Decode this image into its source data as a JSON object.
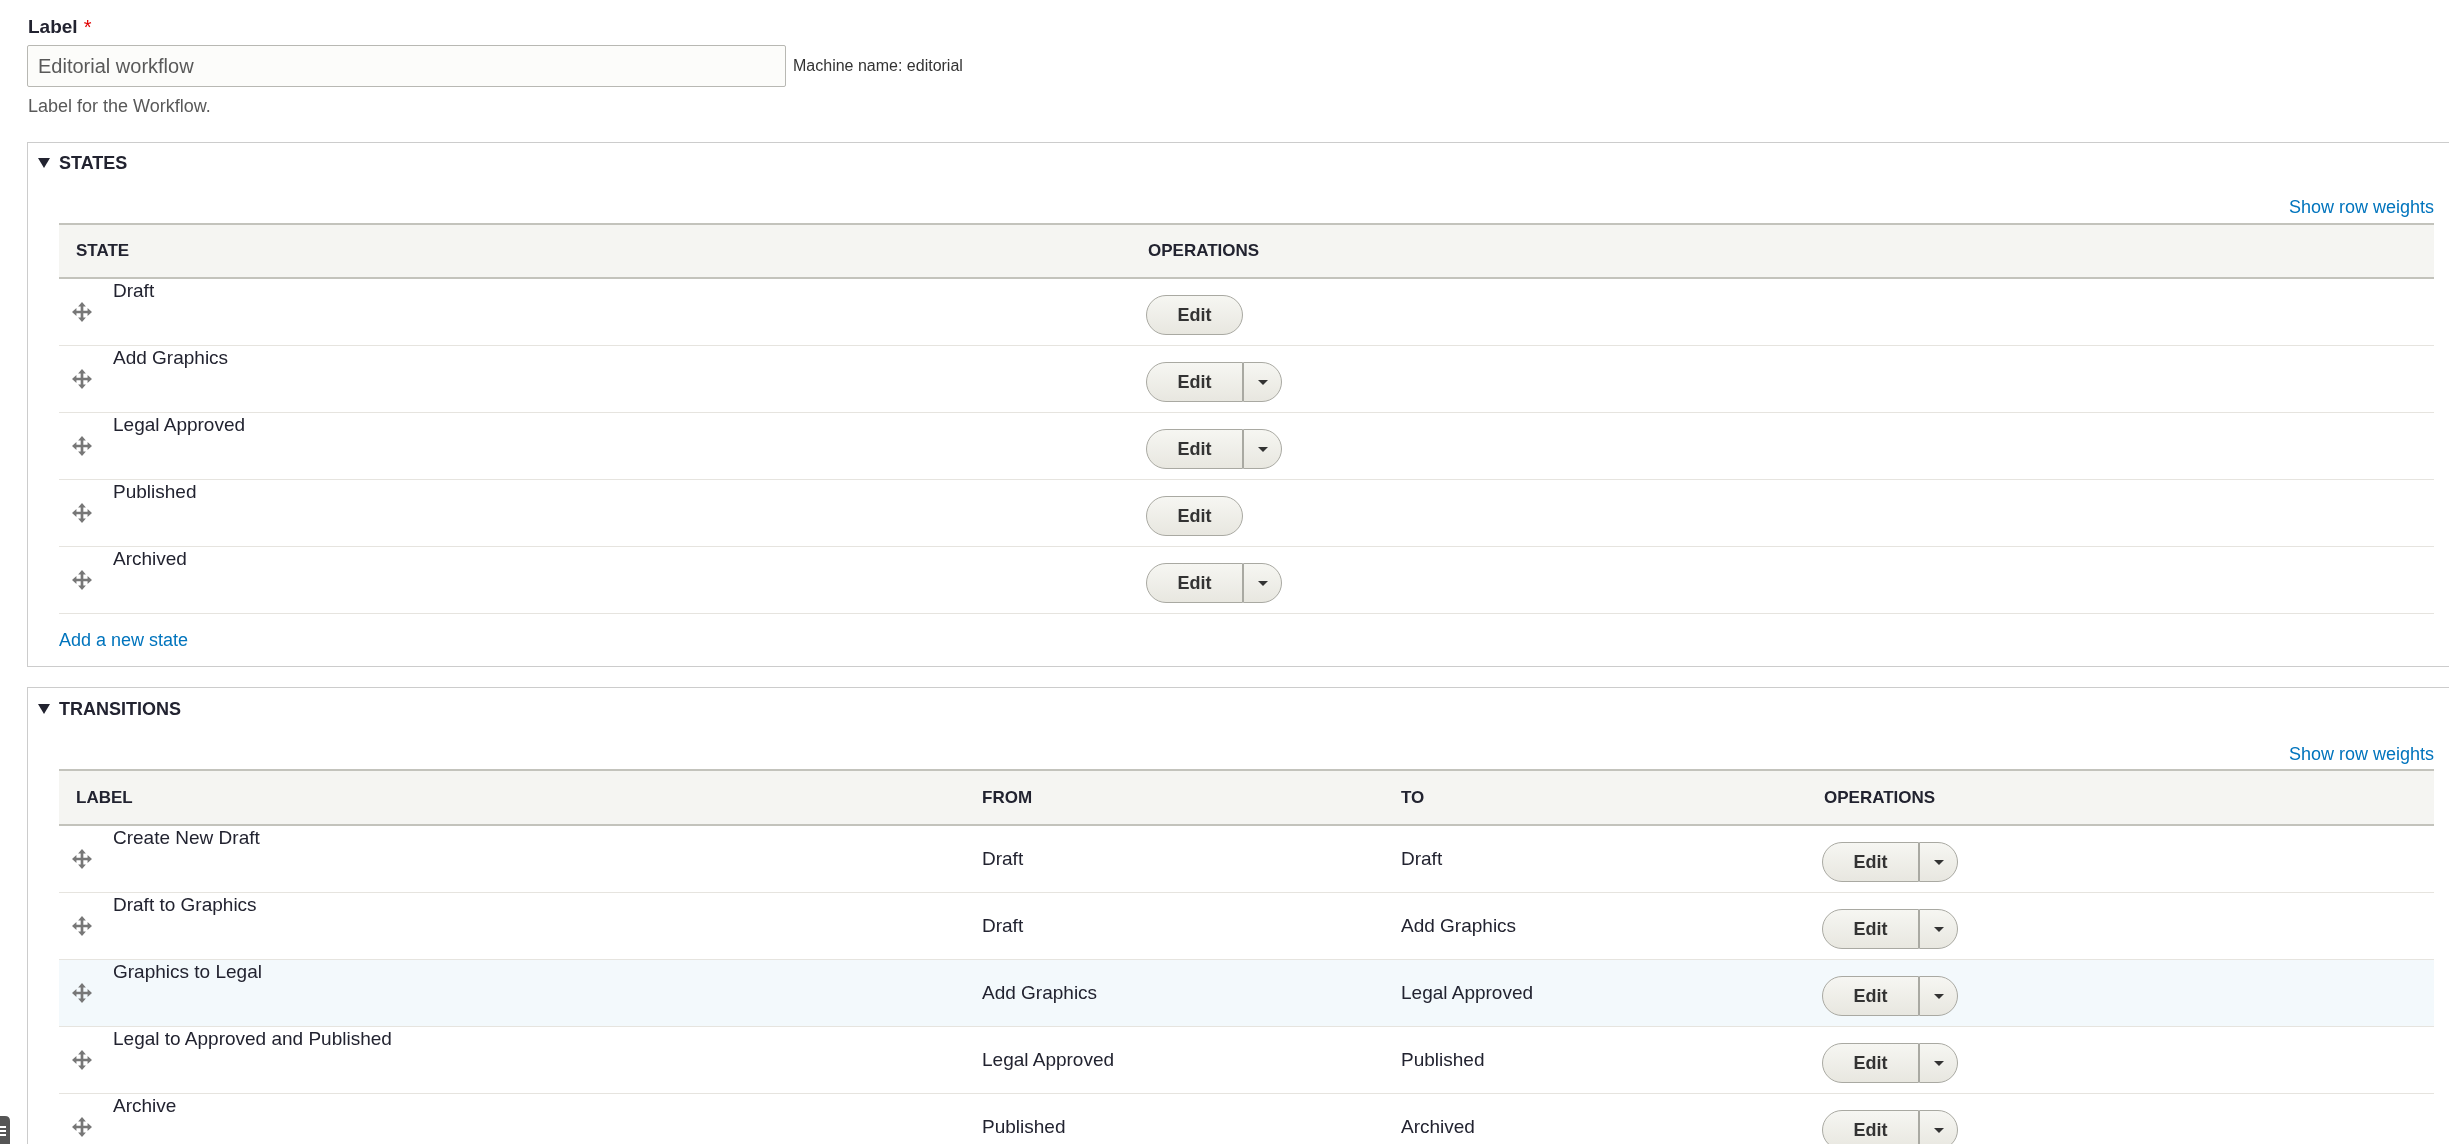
{
  "label_field": {
    "label": "Label",
    "required_mark": "*",
    "value": "Editorial workflow",
    "machine_name": "Machine name: editorial",
    "description": "Label for the Workflow."
  },
  "states": {
    "legend": "STATES",
    "expanded": true,
    "weights_link": "Show row weights",
    "columns": [
      "STATE",
      "OPERATIONS"
    ],
    "rows": [
      {
        "name": "Draft",
        "button": "Edit",
        "has_dropdown": false
      },
      {
        "name": "Add Graphics",
        "button": "Edit",
        "has_dropdown": true
      },
      {
        "name": "Legal Approved",
        "button": "Edit",
        "has_dropdown": true
      },
      {
        "name": "Published",
        "button": "Edit",
        "has_dropdown": false
      },
      {
        "name": "Archived",
        "button": "Edit",
        "has_dropdown": true
      }
    ],
    "add_link": "Add a new state"
  },
  "transitions": {
    "legend": "TRANSITIONS",
    "expanded": true,
    "weights_link": "Show row weights",
    "columns": [
      "LABEL",
      "FROM",
      "TO",
      "OPERATIONS"
    ],
    "rows": [
      {
        "label": "Create New Draft",
        "from": "Draft",
        "to": "Draft",
        "button": "Edit",
        "has_dropdown": true,
        "highlighted": false
      },
      {
        "label": "Draft to Graphics",
        "from": "Draft",
        "to": "Add Graphics",
        "button": "Edit",
        "has_dropdown": true,
        "highlighted": false
      },
      {
        "label": "Graphics to Legal",
        "from": "Add Graphics",
        "to": "Legal Approved",
        "button": "Edit",
        "has_dropdown": true,
        "highlighted": true
      },
      {
        "label": "Legal to Approved and Published",
        "from": "Legal Approved",
        "to": "Published",
        "button": "Edit",
        "has_dropdown": true,
        "highlighted": false
      },
      {
        "label": "Archive",
        "from": "Published",
        "to": "Archived",
        "button": "Edit",
        "has_dropdown": true,
        "highlighted": false
      }
    ]
  }
}
